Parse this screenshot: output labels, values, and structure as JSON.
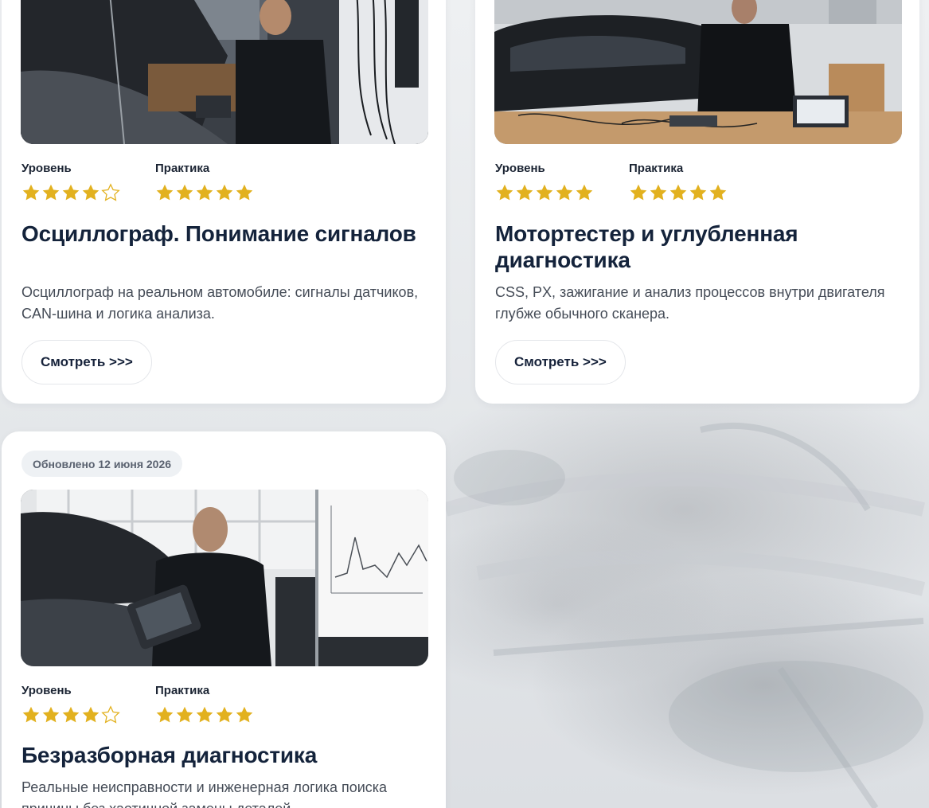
{
  "colors": {
    "star_gold": "#e2b11f",
    "title": "#14233b",
    "text": "#454c57",
    "card_bg": "#ffffff"
  },
  "cards": [
    {
      "level_label": "Уровень",
      "level_stars": 4,
      "practice_label": "Практика",
      "practice_stars": 5,
      "title": "Осциллограф. Понимание сигналов",
      "description": "Осциллограф на реальном автомобиле: сигналы датчиков, CAN-шина и логика анализа.",
      "button_label": "Смотреть >>>"
    },
    {
      "level_label": "Уровень",
      "level_stars": 5,
      "practice_label": "Практика",
      "practice_stars": 5,
      "title": "Мотортестер и углубленная диагностика",
      "description": "CSS, PX, зажигание и анализ процессов внутри двигателя глубже обычного сканера.",
      "button_label": "Смотреть >>>"
    },
    {
      "badge": "Обновлено 12 июня 2026",
      "level_label": "Уровень",
      "level_stars": 4,
      "practice_label": "Практика",
      "practice_stars": 5,
      "title": "Безразборная диагностика",
      "description": "Реальные неисправности и инженерная логика поиска причины без хаотичной замены деталей."
    }
  ]
}
